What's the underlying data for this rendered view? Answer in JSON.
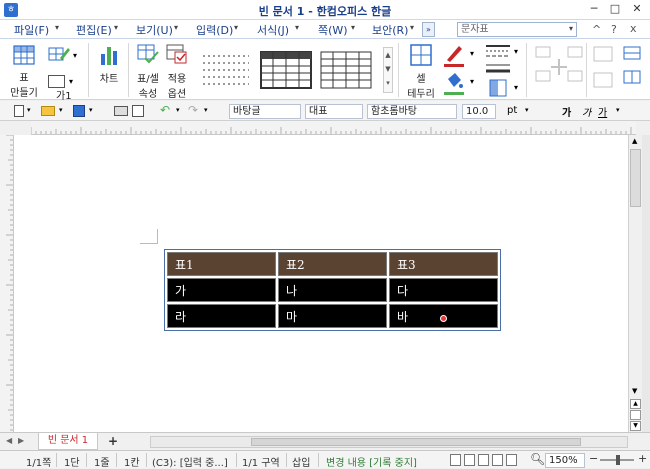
{
  "window": {
    "title": "빈 문서 1 - 한컴오피스 한글",
    "buttons": {
      "minimize": "─",
      "maximize": "□",
      "close": "✕"
    }
  },
  "menu": {
    "items": [
      "파일(F)",
      "편집(E)",
      "보기(U)",
      "입력(D)",
      "서식(J)",
      "쪽(W)",
      "보안(R)"
    ],
    "search_placeholder": "문자표",
    "right_icons": {
      "collapse": "^",
      "help": "?",
      "close": "x"
    }
  },
  "ribbon": {
    "table_label_1": "표",
    "table_label_2": "만들기",
    "row_label": "가1",
    "chart_label": "차트",
    "cell_props_label_1": "표/셀",
    "cell_props_label_2": "속성",
    "apply_label_1": "적용",
    "apply_label_2": "옵션",
    "border_label_1": "셀",
    "border_label_2": "테두리"
  },
  "toolbar": {
    "style": "바탕글",
    "outline": "대표",
    "font": "함초롬바탕",
    "size": "10.0",
    "unit": "pt",
    "bold_sample": "가",
    "italic_sample": "가",
    "underline_sample": "가"
  },
  "table": {
    "header": [
      "표1",
      "표2",
      "표3"
    ],
    "rows": [
      [
        "가",
        "나",
        "다"
      ],
      [
        "라",
        "마",
        "바"
      ]
    ]
  },
  "tabs": {
    "doc_tab": "빈 문서 1",
    "add": "+"
  },
  "status": {
    "page": "1/1쪽",
    "section": "1단",
    "line": "1줄",
    "column": "1칸",
    "cell": "(C3): [입력 중...]",
    "area": "1/1 구역",
    "mode": "삽입",
    "track": "변경 내용 [기록 중지]",
    "zoom": "150%"
  },
  "colors": {
    "header_fill": "#5a4331",
    "body_fill": "#000000",
    "accent": "#1a3f8a",
    "track_text": "#2e7d32",
    "tab_text": "#c62828"
  }
}
